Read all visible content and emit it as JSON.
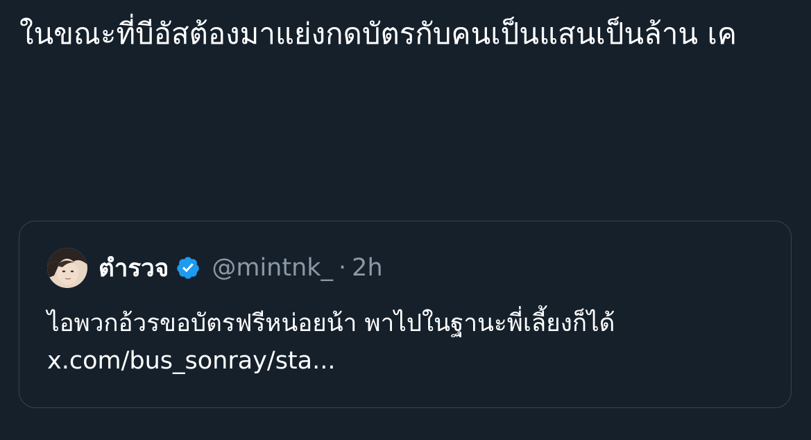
{
  "tweet": {
    "text": "ในขณะที่บีอัสต้องมาแย่งกดบัตรกับคนเป็นแสนเป็นล้าน เค"
  },
  "quote": {
    "display_name": "ตำรวจ",
    "handle": "@mintnk_",
    "separator": "·",
    "time": "2h",
    "text": "ไอพวกอ้วรขอบัตรฟรีหน่อยน้า พาไปในฐานะพี่เลี้ยงก็ได้",
    "link": "x.com/bus_sonray/sta..."
  },
  "colors": {
    "background": "#15202b",
    "text": "#ffffff",
    "secondary_text": "#8b98a5",
    "border": "#38444d",
    "verified": "#1d9bf0"
  },
  "icons": {
    "verified": "verified-badge-icon",
    "avatar": "user-avatar"
  }
}
